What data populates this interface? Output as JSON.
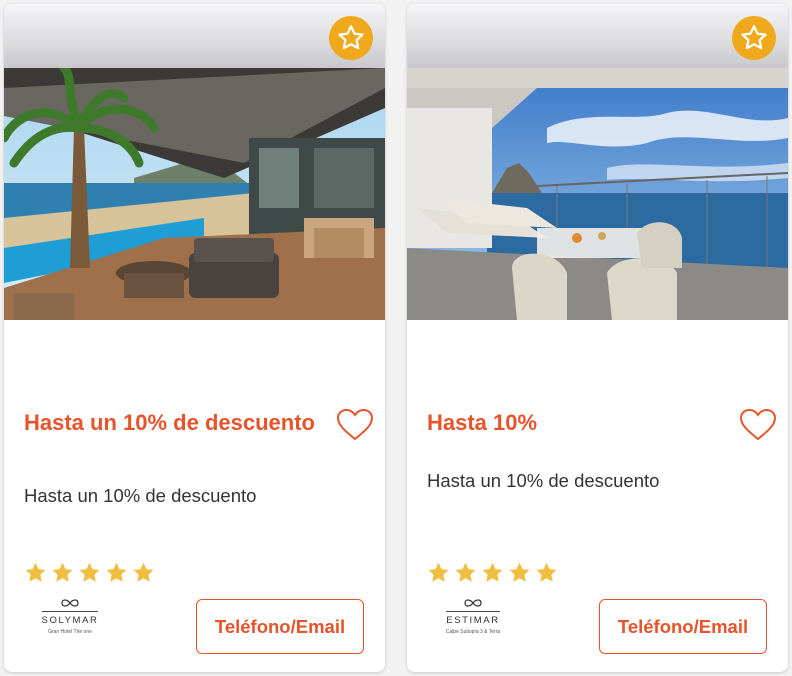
{
  "cards": [
    {
      "title": "Hasta un 10% de descuento",
      "description": "Hasta un 10% de descuento",
      "rating": 5,
      "brand": {
        "name": "SOLYMAR",
        "subtitle": "Gran Hotel  The one"
      },
      "contact_label": "Teléfono/Email",
      "photo_subject": "hotel terrace with palm tree, pool and beach view"
    },
    {
      "title": "Hasta 10%",
      "description": "Hasta un 10% de descuento",
      "rating": 5,
      "brand": {
        "name": "ESTIMAR",
        "subtitle": "Calpe Suitopía 3 & Terra"
      },
      "contact_label": "Teléfono/Email",
      "photo_subject": "balcony with loungers and table overlooking sea and Peñón de Ifach"
    }
  ],
  "icons": {
    "favorite": "star-icon",
    "wishlist": "heart-icon",
    "rating": "star-icon",
    "logo": "infinity-icon"
  },
  "colors": {
    "accent": "#e7532b",
    "favorite_badge": "#f0a81c",
    "rating_star": "#f2be42"
  }
}
